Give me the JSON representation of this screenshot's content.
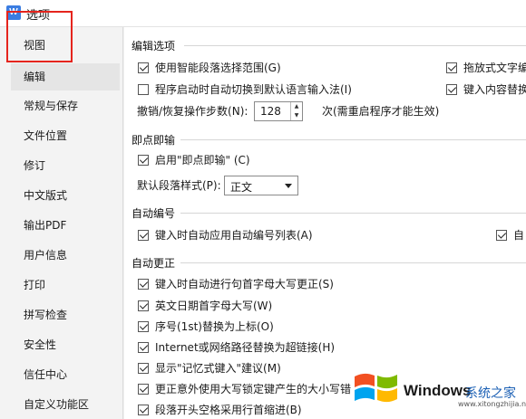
{
  "window": {
    "title": "选项",
    "icon": "app-icon"
  },
  "sidebar": {
    "items": [
      {
        "label": "视图"
      },
      {
        "label": "编辑"
      },
      {
        "label": "常规与保存"
      },
      {
        "label": "文件位置"
      },
      {
        "label": "修订"
      },
      {
        "label": "中文版式"
      },
      {
        "label": "输出PDF"
      },
      {
        "label": "用户信息"
      },
      {
        "label": "打印"
      },
      {
        "label": "拼写检查"
      },
      {
        "label": "安全性"
      },
      {
        "label": "信任中心"
      },
      {
        "label": "自定义功能区"
      }
    ],
    "active_index": 1
  },
  "edit_options": {
    "title": "编辑选项",
    "smart_paragraph": {
      "label": "使用智能段落选择范围(G)",
      "checked": true
    },
    "drag_text": {
      "label": "拖放式文字编",
      "checked": true
    },
    "auto_input_lang": {
      "label": "程序启动时自动切换到默认语言输入法(I)",
      "checked": false
    },
    "replace_on_type": {
      "label": "键入内容替换",
      "checked": true
    },
    "undo_label": "撤销/恢复操作步数(N):",
    "undo_value": "128",
    "undo_note": "次(需重启程序才能生效)"
  },
  "click_and_type": {
    "title": "即点即输",
    "enable": {
      "label": "启用\"即点即输\" (C)",
      "checked": true
    },
    "style_label": "默认段落样式(P):",
    "style_value": "正文"
  },
  "auto_number": {
    "title": "自动编号",
    "auto_list": {
      "label": "键入时自动应用自动编号列表(A)",
      "checked": true
    },
    "right_partial": {
      "label": "自",
      "checked": true
    }
  },
  "auto_correct": {
    "title": "自动更正",
    "items": [
      {
        "label": "键入时自动进行句首字母大写更正(S)",
        "checked": true
      },
      {
        "label": "英文日期首字母大写(W)",
        "checked": true
      },
      {
        "label": "序号(1st)替换为上标(O)",
        "checked": true
      },
      {
        "label": "Internet或网络路径替换为超链接(H)",
        "checked": true
      },
      {
        "label": "显示\"记忆式键入\"建议(M)",
        "checked": true
      },
      {
        "label": "更正意外使用大写锁定键产生的大小写错",
        "checked": true
      },
      {
        "label": "段落开头空格采用行首缩进(B)",
        "checked": true
      }
    ]
  },
  "watermark": {
    "brand": "Windows",
    "site": "系统之家",
    "url": "www.xitongzhijia.net"
  }
}
